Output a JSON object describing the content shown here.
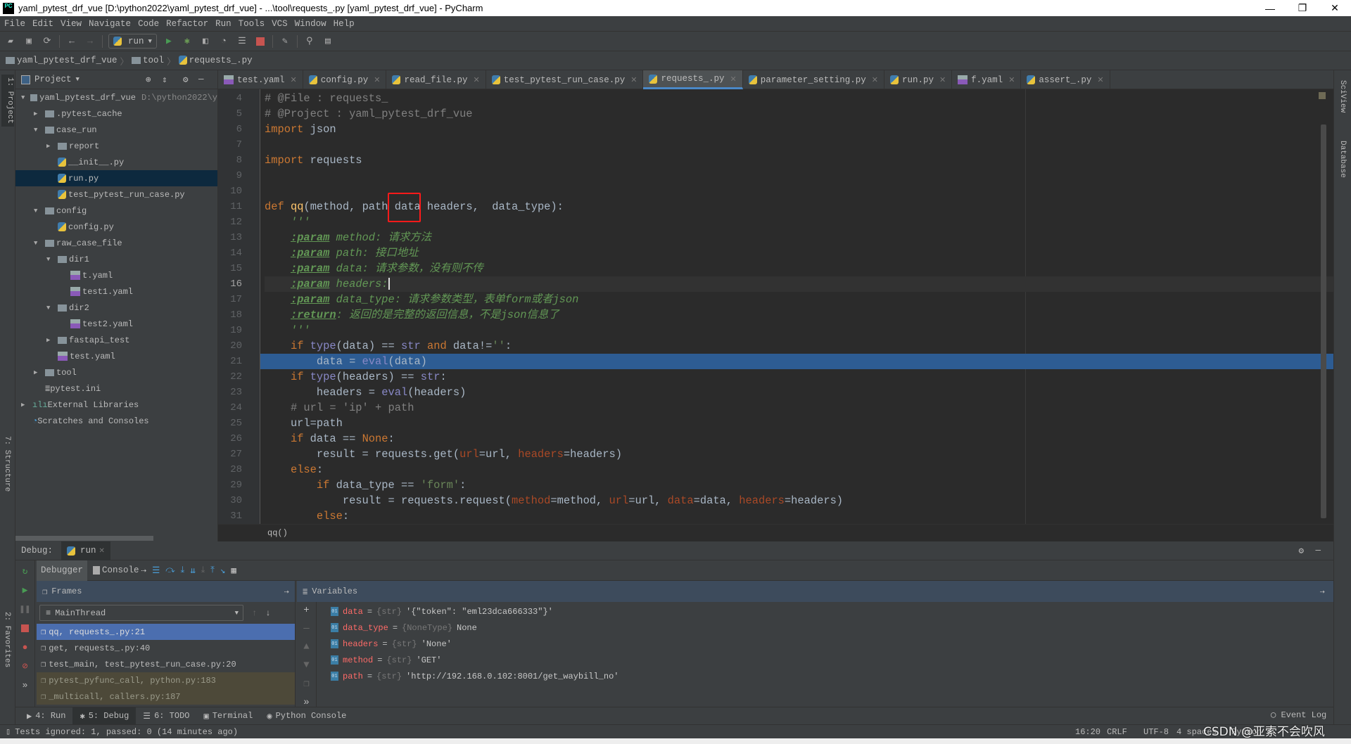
{
  "window": {
    "title": "yaml_pytest_drf_vue [D:\\python2022\\yaml_pytest_drf_vue] - ...\\tool\\requests_.py [yaml_pytest_drf_vue] - PyCharm",
    "logo": "PC",
    "minimize": "—",
    "restore": "❐",
    "close": "✕"
  },
  "menu": [
    "File",
    "Edit",
    "View",
    "Navigate",
    "Code",
    "Refactor",
    "Run",
    "Tools",
    "VCS",
    "Window",
    "Help"
  ],
  "toolbar": {
    "run_config": "run"
  },
  "breadcrumb": [
    "yaml_pytest_drf_vue",
    "tool",
    "requests_.py"
  ],
  "left_stripe": {
    "project": "1: Project",
    "structure": "7: Structure",
    "favorites": "2: Favorites"
  },
  "right_stripe": {
    "sciview": "SciView",
    "database": "Database"
  },
  "project": {
    "header": "Project",
    "items": [
      {
        "label": "yaml_pytest_drf_vue",
        "hint": "D:\\python2022\\y",
        "type": "folder",
        "level": 0,
        "expanded": true
      },
      {
        "label": ".pytest_cache",
        "type": "folder",
        "level": 1,
        "expanded": false
      },
      {
        "label": "case_run",
        "type": "folder",
        "level": 1,
        "expanded": true
      },
      {
        "label": "report",
        "type": "folder",
        "level": 2,
        "expanded": false
      },
      {
        "label": "__init__.py",
        "type": "py",
        "level": 2
      },
      {
        "label": "run.py",
        "type": "py",
        "level": 2,
        "selected": true
      },
      {
        "label": "test_pytest_run_case.py",
        "type": "py",
        "level": 2
      },
      {
        "label": "config",
        "type": "folder",
        "level": 1,
        "expanded": true
      },
      {
        "label": "config.py",
        "type": "py",
        "level": 2
      },
      {
        "label": "raw_case_file",
        "type": "folder",
        "level": 1,
        "expanded": true
      },
      {
        "label": "dir1",
        "type": "folder",
        "level": 2,
        "expanded": true
      },
      {
        "label": "t.yaml",
        "type": "yaml",
        "level": 3
      },
      {
        "label": "test1.yaml",
        "type": "yaml",
        "level": 3
      },
      {
        "label": "dir2",
        "type": "folder",
        "level": 2,
        "expanded": true
      },
      {
        "label": "test2.yaml",
        "type": "yaml",
        "level": 3
      },
      {
        "label": "fastapi_test",
        "type": "folder",
        "level": 2,
        "expanded": false
      },
      {
        "label": "test.yaml",
        "type": "yaml",
        "level": 2
      },
      {
        "label": "tool",
        "type": "folder",
        "level": 1,
        "expanded": false
      },
      {
        "label": "pytest.ini",
        "type": "ini",
        "level": 1
      },
      {
        "label": "External Libraries",
        "type": "lib",
        "level": 0,
        "expanded": false
      },
      {
        "label": "Scratches and Consoles",
        "type": "scratch",
        "level": 0
      }
    ]
  },
  "tabs": [
    {
      "label": "test.yaml",
      "type": "yaml"
    },
    {
      "label": "config.py",
      "type": "py"
    },
    {
      "label": "read_file.py",
      "type": "py"
    },
    {
      "label": "test_pytest_run_case.py",
      "type": "py"
    },
    {
      "label": "requests_.py",
      "type": "py",
      "active": true
    },
    {
      "label": "parameter_setting.py",
      "type": "py"
    },
    {
      "label": "run.py",
      "type": "py"
    },
    {
      "label": "f.yaml",
      "type": "yaml"
    },
    {
      "label": "assert_.py",
      "type": "py"
    }
  ],
  "editor": {
    "current_line": 16,
    "execution_line": 21,
    "lines": [
      {
        "n": 4,
        "t": [
          [
            "# @File : requests_",
            "cm"
          ]
        ]
      },
      {
        "n": 5,
        "t": [
          [
            "# @Project : yaml_pytest_drf_vue",
            "cm"
          ]
        ]
      },
      {
        "n": 6,
        "t": [
          [
            "import",
            "kw"
          ],
          [
            " json",
            ""
          ]
        ]
      },
      {
        "n": 7,
        "t": []
      },
      {
        "n": 8,
        "t": [
          [
            "import",
            "kw"
          ],
          [
            " requests",
            ""
          ]
        ]
      },
      {
        "n": 9,
        "t": []
      },
      {
        "n": 10,
        "t": []
      },
      {
        "n": 11,
        "t": [
          [
            "def",
            "kw"
          ],
          [
            " ",
            ""
          ],
          [
            "qq",
            "fn"
          ],
          [
            "(method, path data headers,  data_type):",
            ""
          ]
        ]
      },
      {
        "n": 12,
        "t": [
          [
            "    '''",
            "doc"
          ]
        ]
      },
      {
        "n": 13,
        "t": [
          [
            "    ",
            ""
          ],
          [
            ":param",
            "dtag"
          ],
          [
            " method: 请求方法",
            "doc"
          ]
        ]
      },
      {
        "n": 14,
        "t": [
          [
            "    ",
            ""
          ],
          [
            ":param",
            "dtag"
          ],
          [
            " path: 接口地址",
            "doc"
          ]
        ]
      },
      {
        "n": 15,
        "t": [
          [
            "    ",
            ""
          ],
          [
            ":param",
            "dtag"
          ],
          [
            " data: 请求参数，没有则不传",
            "doc"
          ]
        ]
      },
      {
        "n": 16,
        "t": [
          [
            "    ",
            ""
          ],
          [
            ":param",
            "dtag"
          ],
          [
            " headers:",
            "doc"
          ]
        ]
      },
      {
        "n": 17,
        "t": [
          [
            "    ",
            ""
          ],
          [
            ":param",
            "dtag"
          ],
          [
            " data_type: 请求参数类型，表单form或者json",
            "doc"
          ]
        ]
      },
      {
        "n": 18,
        "t": [
          [
            "    ",
            ""
          ],
          [
            ":return",
            "dtag"
          ],
          [
            ": 返回的是完整的返回信息，不是json信息了",
            "doc"
          ]
        ]
      },
      {
        "n": 19,
        "t": [
          [
            "    '''",
            "doc"
          ]
        ]
      },
      {
        "n": 20,
        "t": [
          [
            "    ",
            ""
          ],
          [
            "if",
            "kw"
          ],
          [
            " ",
            ""
          ],
          [
            "type",
            "bi"
          ],
          [
            "(data) == ",
            ""
          ],
          [
            "str",
            "bi"
          ],
          [
            " ",
            ""
          ],
          [
            "and",
            "kw"
          ],
          [
            " data!=",
            ""
          ],
          [
            "''",
            "st"
          ],
          [
            ":",
            ""
          ]
        ]
      },
      {
        "n": 21,
        "t": [
          [
            "        data = ",
            ""
          ],
          [
            "eval",
            "bi"
          ],
          [
            "(data)",
            ""
          ]
        ]
      },
      {
        "n": 22,
        "t": [
          [
            "    ",
            ""
          ],
          [
            "if",
            "kw"
          ],
          [
            " ",
            ""
          ],
          [
            "type",
            "bi"
          ],
          [
            "(headers) == ",
            ""
          ],
          [
            "str",
            "bi"
          ],
          [
            ":",
            ""
          ]
        ]
      },
      {
        "n": 23,
        "t": [
          [
            "        headers = ",
            ""
          ],
          [
            "eval",
            "bi"
          ],
          [
            "(headers)",
            ""
          ]
        ]
      },
      {
        "n": 24,
        "t": [
          [
            "    # url = 'ip' + path",
            "cm"
          ]
        ]
      },
      {
        "n": 25,
        "t": [
          [
            "    url=path",
            ""
          ]
        ]
      },
      {
        "n": 26,
        "t": [
          [
            "    ",
            ""
          ],
          [
            "if",
            "kw"
          ],
          [
            " data == ",
            ""
          ],
          [
            "None",
            "kw"
          ],
          [
            ":",
            ""
          ]
        ]
      },
      {
        "n": 27,
        "t": [
          [
            "        result = requests.get(",
            ""
          ],
          [
            "url",
            "na"
          ],
          [
            "=url, ",
            ""
          ],
          [
            "headers",
            "na"
          ],
          [
            "=headers)",
            ""
          ]
        ]
      },
      {
        "n": 28,
        "t": [
          [
            "    ",
            ""
          ],
          [
            "else",
            "kw"
          ],
          [
            ":",
            ""
          ]
        ]
      },
      {
        "n": 29,
        "t": [
          [
            "        ",
            ""
          ],
          [
            "if",
            "kw"
          ],
          [
            " data_type == ",
            ""
          ],
          [
            "'form'",
            "st"
          ],
          [
            ":",
            ""
          ]
        ]
      },
      {
        "n": 30,
        "t": [
          [
            "            result = requests.request(",
            ""
          ],
          [
            "method",
            "na"
          ],
          [
            "=method, ",
            ""
          ],
          [
            "url",
            "na"
          ],
          [
            "=url, ",
            ""
          ],
          [
            "data",
            "na"
          ],
          [
            "=data, ",
            ""
          ],
          [
            "headers",
            "na"
          ],
          [
            "=headers)",
            ""
          ]
        ]
      },
      {
        "n": 31,
        "t": [
          [
            "        ",
            ""
          ],
          [
            "else",
            "kw"
          ],
          [
            ":",
            ""
          ]
        ]
      }
    ],
    "crumb": "qq()"
  },
  "debug": {
    "label": "Debug:",
    "session": "run",
    "tabs": {
      "debugger": "Debugger",
      "console": "Console"
    },
    "frames_header": "Frames",
    "variables_header": "Variables",
    "thread": "MainThread",
    "frames": [
      {
        "label": "qq, requests_.py:21",
        "state": "selected"
      },
      {
        "label": "get, requests_.py:40",
        "state": "normal"
      },
      {
        "label": "test_main, test_pytest_run_case.py:20",
        "state": "normal"
      },
      {
        "label": "pytest_pyfunc_call, python.py:183",
        "state": "library"
      },
      {
        "label": "_multicall, callers.py:187",
        "state": "library"
      }
    ],
    "variables": [
      {
        "name": "data",
        "type": "{str}",
        "value": "'{\"token\": \"eml23dca666333\"}'"
      },
      {
        "name": "data_type",
        "type": "{NoneType}",
        "value": "None"
      },
      {
        "name": "headers",
        "type": "{str}",
        "value": "'None'"
      },
      {
        "name": "method",
        "type": "{str}",
        "value": "'GET'"
      },
      {
        "name": "path",
        "type": "{str}",
        "value": "'http://192.168.0.102:8001/get_waybill_no'"
      }
    ]
  },
  "bottom_tabs": [
    {
      "label": "4: Run",
      "icon": "play-icon"
    },
    {
      "label": "5: Debug",
      "icon": "bug-icon",
      "active": true
    },
    {
      "label": "6: TODO",
      "icon": "list-icon"
    },
    {
      "label": "Terminal",
      "icon": "terminal-icon"
    },
    {
      "label": "Python Console",
      "icon": "python-icon"
    }
  ],
  "event_log": "Event Log",
  "status": {
    "message": "Tests ignored: 1, passed: 0 (14 minutes ago)",
    "position": "16:20",
    "line_sep": "CRLF",
    "encoding": "UTF-8",
    "indent": "4 spaces",
    "interpreter": "Python 3"
  },
  "watermark": "CSDN @亚索不会吹风"
}
